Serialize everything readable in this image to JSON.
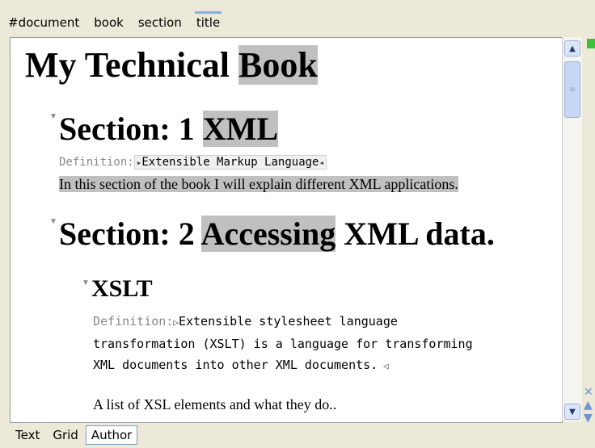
{
  "breadcrumb": [
    "#document",
    "book",
    "section",
    "title"
  ],
  "book": {
    "title_text": "My Technical ",
    "title_hl": "Book"
  },
  "section1": {
    "title_text": "Section: 1 ",
    "title_hl": "XML",
    "def_label": "Definition:",
    "def_value": "Extensible Markup Language",
    "para": "In this section of the book I will explain different XML applications."
  },
  "section2": {
    "title_pre": "Section: 2 ",
    "title_hl": "Accessing",
    "title_post": " XML data.",
    "sub": {
      "title": "XSLT",
      "def_label": "Definition:",
      "def_value": "Extensible stylesheet language transformation (XSLT) is a language for transforming XML documents into other XML documents.",
      "para": "A list of XSL elements and what they do.."
    }
  },
  "tabs": {
    "text": "Text",
    "grid": "Grid",
    "author": "Author",
    "active": "Author"
  },
  "icons": {
    "scroll_up": "triangle-up-icon",
    "scroll_down": "triangle-down-icon",
    "fold": "fold-triangle-icon"
  },
  "colors": {
    "highlight": "#c0c0c0",
    "active_marker": "#9fc4ef",
    "status_ok": "#3ec03e"
  }
}
